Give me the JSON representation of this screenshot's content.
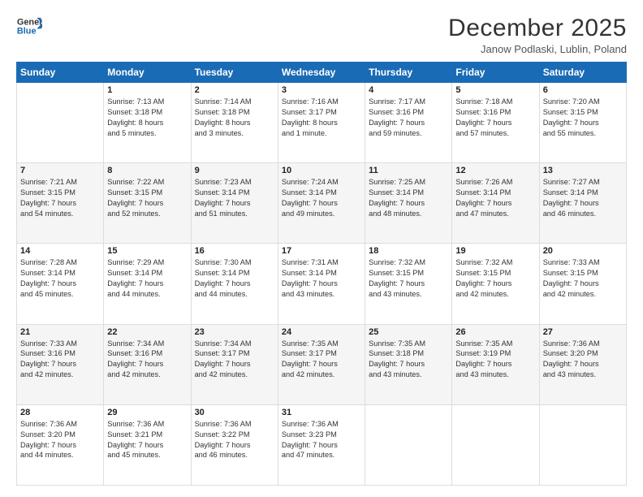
{
  "logo": {
    "line1": "General",
    "line2": "Blue"
  },
  "title": "December 2025",
  "location": "Janow Podlaski, Lublin, Poland",
  "days_of_week": [
    "Sunday",
    "Monday",
    "Tuesday",
    "Wednesday",
    "Thursday",
    "Friday",
    "Saturday"
  ],
  "weeks": [
    [
      {
        "day": "",
        "text": ""
      },
      {
        "day": "1",
        "text": "Sunrise: 7:13 AM\nSunset: 3:18 PM\nDaylight: 8 hours\nand 5 minutes."
      },
      {
        "day": "2",
        "text": "Sunrise: 7:14 AM\nSunset: 3:18 PM\nDaylight: 8 hours\nand 3 minutes."
      },
      {
        "day": "3",
        "text": "Sunrise: 7:16 AM\nSunset: 3:17 PM\nDaylight: 8 hours\nand 1 minute."
      },
      {
        "day": "4",
        "text": "Sunrise: 7:17 AM\nSunset: 3:16 PM\nDaylight: 7 hours\nand 59 minutes."
      },
      {
        "day": "5",
        "text": "Sunrise: 7:18 AM\nSunset: 3:16 PM\nDaylight: 7 hours\nand 57 minutes."
      },
      {
        "day": "6",
        "text": "Sunrise: 7:20 AM\nSunset: 3:15 PM\nDaylight: 7 hours\nand 55 minutes."
      }
    ],
    [
      {
        "day": "7",
        "text": "Sunrise: 7:21 AM\nSunset: 3:15 PM\nDaylight: 7 hours\nand 54 minutes."
      },
      {
        "day": "8",
        "text": "Sunrise: 7:22 AM\nSunset: 3:15 PM\nDaylight: 7 hours\nand 52 minutes."
      },
      {
        "day": "9",
        "text": "Sunrise: 7:23 AM\nSunset: 3:14 PM\nDaylight: 7 hours\nand 51 minutes."
      },
      {
        "day": "10",
        "text": "Sunrise: 7:24 AM\nSunset: 3:14 PM\nDaylight: 7 hours\nand 49 minutes."
      },
      {
        "day": "11",
        "text": "Sunrise: 7:25 AM\nSunset: 3:14 PM\nDaylight: 7 hours\nand 48 minutes."
      },
      {
        "day": "12",
        "text": "Sunrise: 7:26 AM\nSunset: 3:14 PM\nDaylight: 7 hours\nand 47 minutes."
      },
      {
        "day": "13",
        "text": "Sunrise: 7:27 AM\nSunset: 3:14 PM\nDaylight: 7 hours\nand 46 minutes."
      }
    ],
    [
      {
        "day": "14",
        "text": "Sunrise: 7:28 AM\nSunset: 3:14 PM\nDaylight: 7 hours\nand 45 minutes."
      },
      {
        "day": "15",
        "text": "Sunrise: 7:29 AM\nSunset: 3:14 PM\nDaylight: 7 hours\nand 44 minutes."
      },
      {
        "day": "16",
        "text": "Sunrise: 7:30 AM\nSunset: 3:14 PM\nDaylight: 7 hours\nand 44 minutes."
      },
      {
        "day": "17",
        "text": "Sunrise: 7:31 AM\nSunset: 3:14 PM\nDaylight: 7 hours\nand 43 minutes."
      },
      {
        "day": "18",
        "text": "Sunrise: 7:32 AM\nSunset: 3:15 PM\nDaylight: 7 hours\nand 43 minutes."
      },
      {
        "day": "19",
        "text": "Sunrise: 7:32 AM\nSunset: 3:15 PM\nDaylight: 7 hours\nand 42 minutes."
      },
      {
        "day": "20",
        "text": "Sunrise: 7:33 AM\nSunset: 3:15 PM\nDaylight: 7 hours\nand 42 minutes."
      }
    ],
    [
      {
        "day": "21",
        "text": "Sunrise: 7:33 AM\nSunset: 3:16 PM\nDaylight: 7 hours\nand 42 minutes."
      },
      {
        "day": "22",
        "text": "Sunrise: 7:34 AM\nSunset: 3:16 PM\nDaylight: 7 hours\nand 42 minutes."
      },
      {
        "day": "23",
        "text": "Sunrise: 7:34 AM\nSunset: 3:17 PM\nDaylight: 7 hours\nand 42 minutes."
      },
      {
        "day": "24",
        "text": "Sunrise: 7:35 AM\nSunset: 3:17 PM\nDaylight: 7 hours\nand 42 minutes."
      },
      {
        "day": "25",
        "text": "Sunrise: 7:35 AM\nSunset: 3:18 PM\nDaylight: 7 hours\nand 43 minutes."
      },
      {
        "day": "26",
        "text": "Sunrise: 7:35 AM\nSunset: 3:19 PM\nDaylight: 7 hours\nand 43 minutes."
      },
      {
        "day": "27",
        "text": "Sunrise: 7:36 AM\nSunset: 3:20 PM\nDaylight: 7 hours\nand 43 minutes."
      }
    ],
    [
      {
        "day": "28",
        "text": "Sunrise: 7:36 AM\nSunset: 3:20 PM\nDaylight: 7 hours\nand 44 minutes."
      },
      {
        "day": "29",
        "text": "Sunrise: 7:36 AM\nSunset: 3:21 PM\nDaylight: 7 hours\nand 45 minutes."
      },
      {
        "day": "30",
        "text": "Sunrise: 7:36 AM\nSunset: 3:22 PM\nDaylight: 7 hours\nand 46 minutes."
      },
      {
        "day": "31",
        "text": "Sunrise: 7:36 AM\nSunset: 3:23 PM\nDaylight: 7 hours\nand 47 minutes."
      },
      {
        "day": "",
        "text": ""
      },
      {
        "day": "",
        "text": ""
      },
      {
        "day": "",
        "text": ""
      }
    ]
  ]
}
